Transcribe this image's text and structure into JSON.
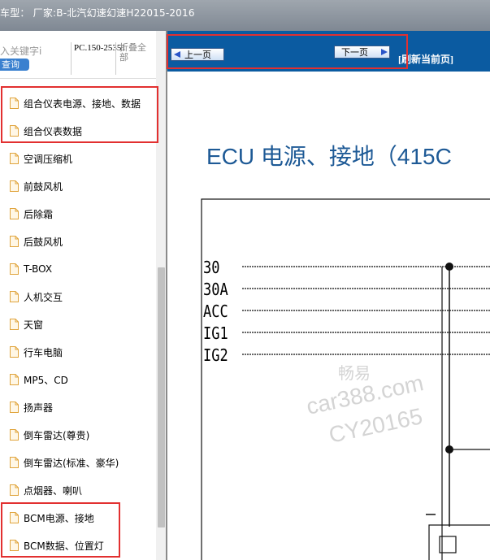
{
  "window": {
    "title": "车型：  厂家:B-北汽幻速幻速H22015-2016"
  },
  "sidebar": {
    "search_hint": "入关键字і",
    "search_button": "查询",
    "code": "PC.150-25351",
    "fold": "折叠全部",
    "items": [
      {
        "label": "组合仪表电源、接地、数据"
      },
      {
        "label": "组合仪表数据"
      },
      {
        "label": "空调压缩机"
      },
      {
        "label": "前鼓风机"
      },
      {
        "label": "后除霜"
      },
      {
        "label": "后鼓风机"
      },
      {
        "label": "T-BOX"
      },
      {
        "label": "人机交互"
      },
      {
        "label": "天窗"
      },
      {
        "label": "行车电脑"
      },
      {
        "label": "MP5、CD"
      },
      {
        "label": "扬声器"
      },
      {
        "label": "倒车雷达(尊贵)"
      },
      {
        "label": "倒车雷达(标准、豪华)"
      },
      {
        "label": "点烟器、喇叭"
      },
      {
        "label": "BCM电源、接地"
      },
      {
        "label": "BCM数据、位置灯"
      }
    ]
  },
  "toolbar": {
    "prev_label": "上一页",
    "next_label": "下一页",
    "refresh_label": "[刷新当前页]"
  },
  "diagram": {
    "title": "ECU 电源、接地（415C",
    "pins": [
      "30",
      "30A",
      "ACC",
      "IG1",
      "IG2"
    ],
    "watermark": [
      "畅易",
      "car388.com",
      "CY20165"
    ]
  },
  "colors": {
    "toolbar_bg": "#0b5ba1",
    "title_color": "#1e5a96",
    "highlight": "#e23030",
    "search_button": "#3a80cf"
  }
}
